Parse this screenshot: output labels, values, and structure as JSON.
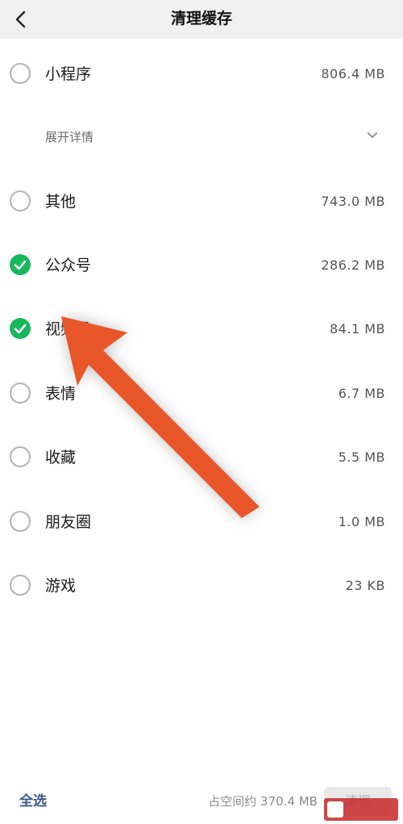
{
  "header": {
    "title": "清理缓存"
  },
  "icons": {
    "back": "chevron-left-icon",
    "expand": "chevron-down-icon",
    "check": "check-icon",
    "annotation": "arrow-icon"
  },
  "expand": {
    "label": "展开详情"
  },
  "items": [
    {
      "label": "小程序",
      "size": "806.4 MB",
      "checked": false
    },
    {
      "label": "其他",
      "size": "743.0 MB",
      "checked": false
    },
    {
      "label": "公众号",
      "size": "286.2 MB",
      "checked": true
    },
    {
      "label": "视频号",
      "size": "84.1 MB",
      "checked": true
    },
    {
      "label": "表情",
      "size": "6.7 MB",
      "checked": false
    },
    {
      "label": "收藏",
      "size": "5.5 MB",
      "checked": false
    },
    {
      "label": "朋友圈",
      "size": "1.0 MB",
      "checked": false
    },
    {
      "label": "游戏",
      "size": "23 KB",
      "checked": false
    }
  ],
  "footer": {
    "select_all": "全选",
    "usage": "占空间约 370.4 MB",
    "clear": "清理"
  },
  "colors": {
    "accent_green": "#17b85c",
    "link_blue": "#3a5b8a",
    "annotation_orange": "#e8562a"
  }
}
